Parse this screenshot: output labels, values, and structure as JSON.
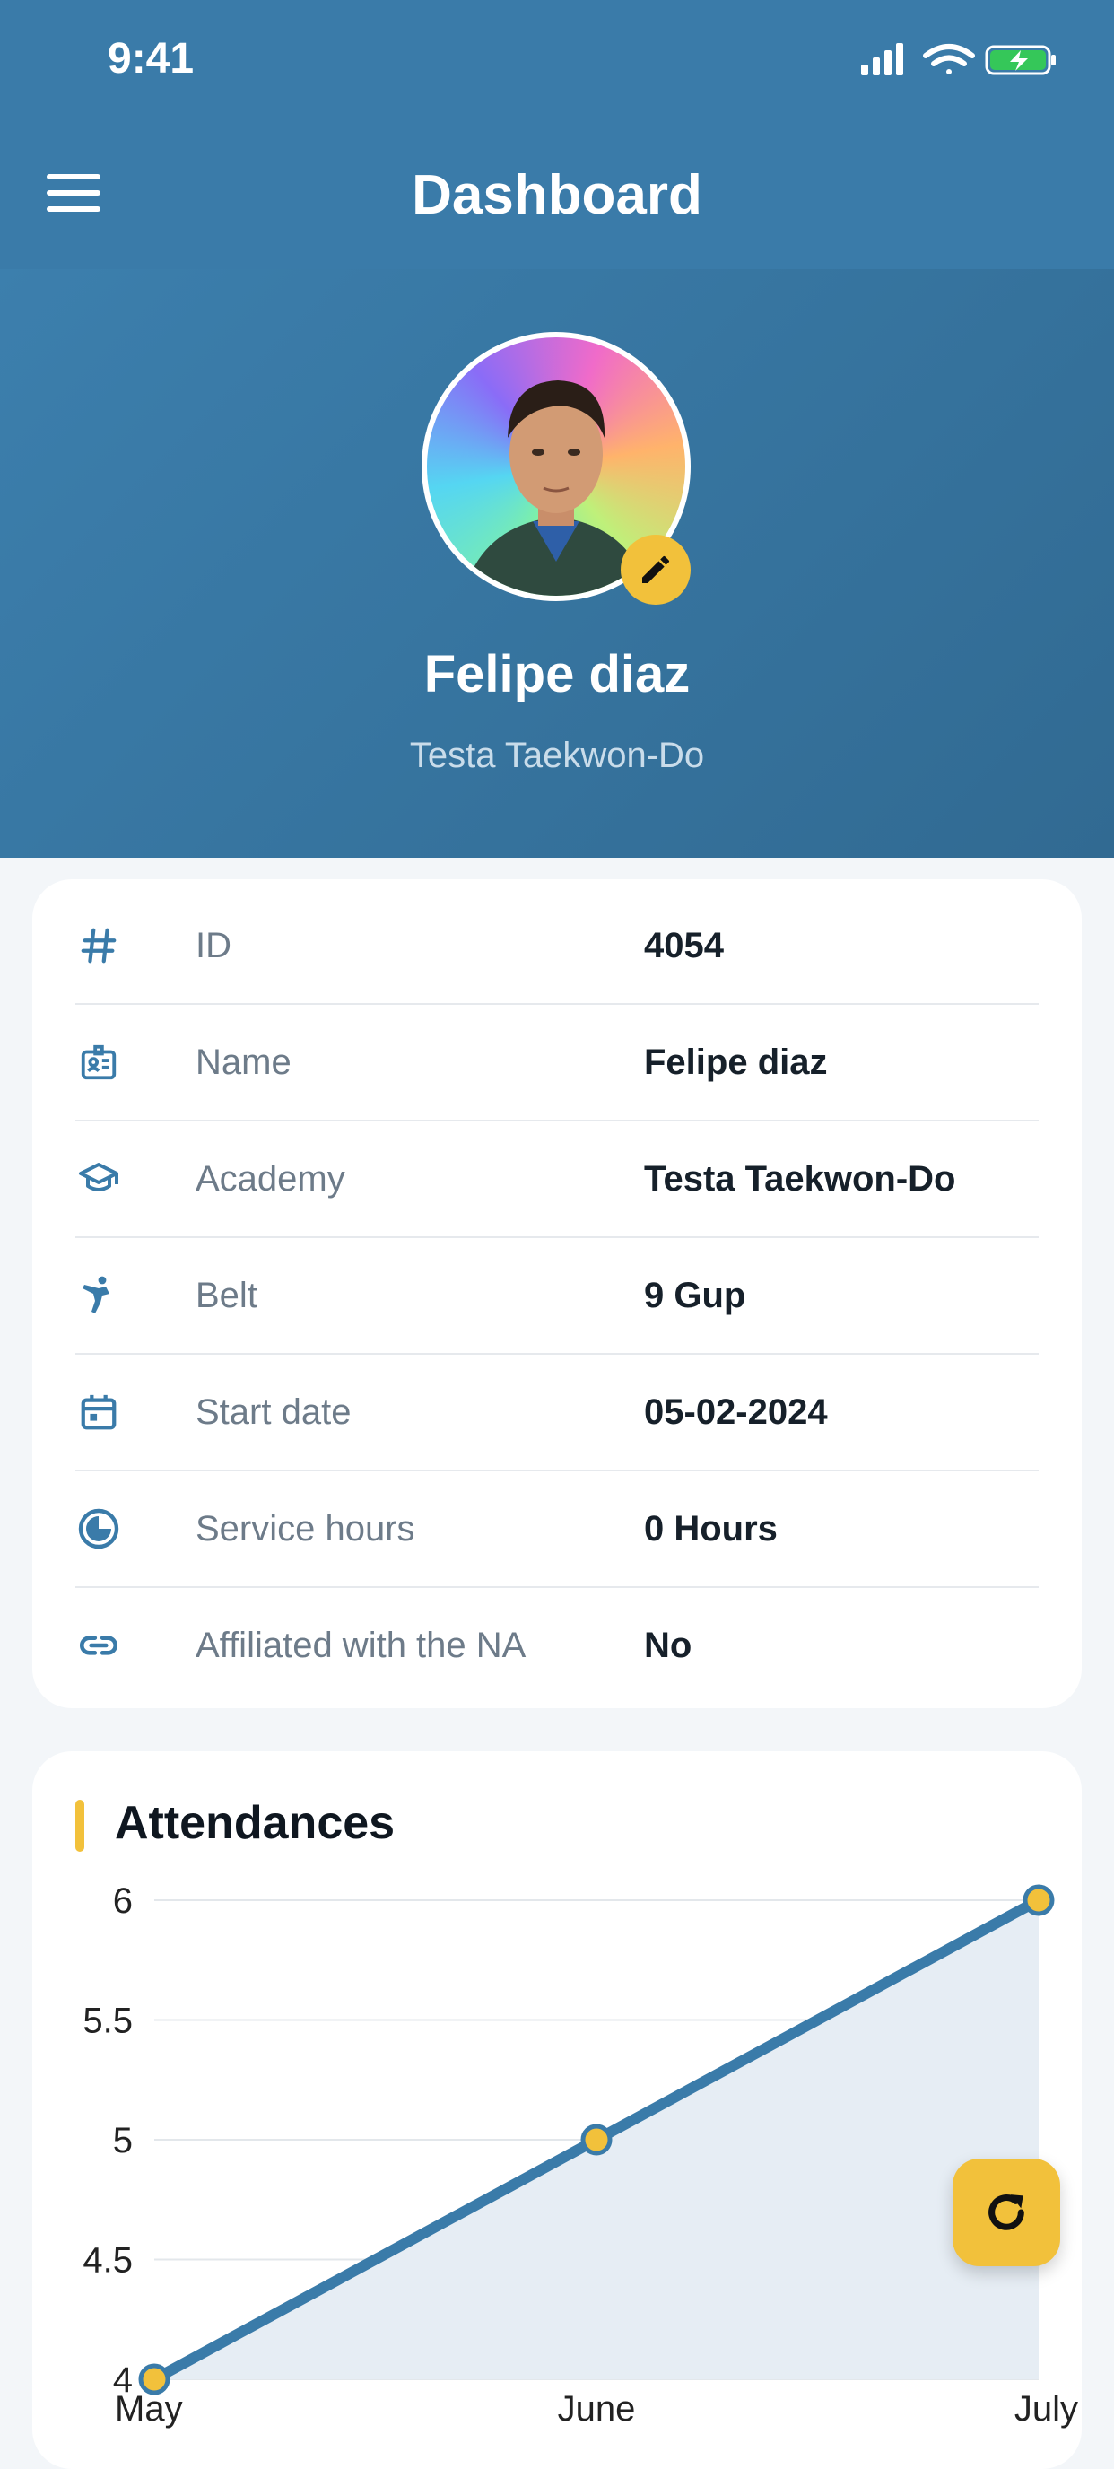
{
  "status_bar": {
    "time": "9:41"
  },
  "header": {
    "title": "Dashboard"
  },
  "profile": {
    "name": "Felipe diaz",
    "academy": "Testa Taekwon-Do"
  },
  "info": {
    "rows": [
      {
        "icon": "hash-icon",
        "label": "ID",
        "value": "4054"
      },
      {
        "icon": "id-card-icon",
        "label": "Name",
        "value": "Felipe diaz"
      },
      {
        "icon": "graduation-cap-icon",
        "label": "Academy",
        "value": "Testa Taekwon-Do"
      },
      {
        "icon": "martial-arts-kick-icon",
        "label": "Belt",
        "value": "9 Gup"
      },
      {
        "icon": "calendar-icon",
        "label": "Start date",
        "value": "05-02-2024"
      },
      {
        "icon": "clock-icon",
        "label": "Service hours",
        "value": "0 Hours"
      },
      {
        "icon": "link-icon",
        "label": "Affiliated with the NA",
        "value": "No"
      }
    ]
  },
  "attendances": {
    "title": "Attendances"
  },
  "chart_data": {
    "type": "area",
    "title": "Attendances",
    "categories": [
      "May",
      "June",
      "July"
    ],
    "values": [
      4,
      5,
      6
    ],
    "ylim": [
      4,
      6
    ],
    "yticks": [
      "4",
      "4.5",
      "5",
      "5.5",
      "6"
    ],
    "grid": true,
    "line_color": "#3a7ba9",
    "marker_color": "#f2c13b"
  },
  "colors": {
    "primary": "#3a7ba9",
    "accent": "#f2c13b"
  }
}
